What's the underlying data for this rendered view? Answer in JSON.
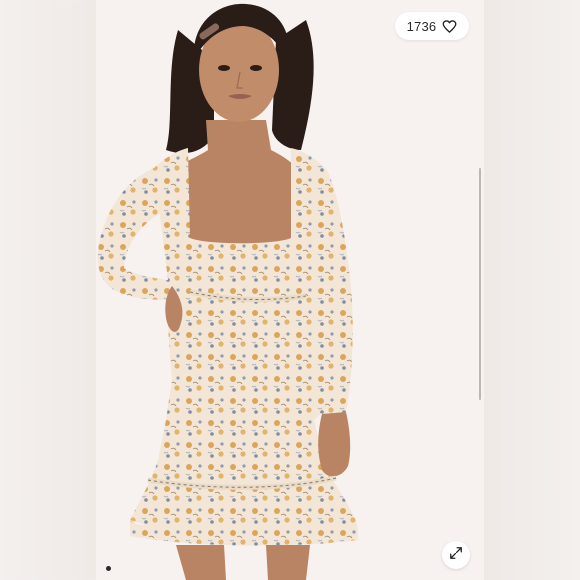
{
  "listing": {
    "like_count": "1736",
    "like_icon": "heart-outline-icon",
    "expand_icon": "expand-arrows-icon",
    "active_photo_index": 1
  },
  "colors": {
    "background": "#f3eeec",
    "dress_base": "#f2e2cf",
    "dress_flower": "#d9a45a",
    "dress_leaf": "#8b9bb0",
    "skin": "#b98463",
    "hair": "#2a1d17"
  }
}
